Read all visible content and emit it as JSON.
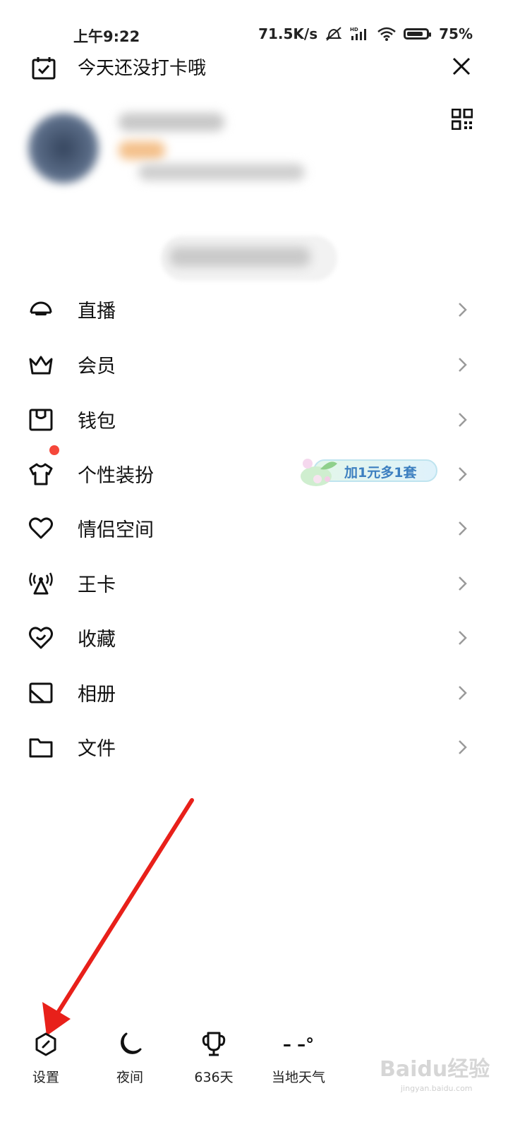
{
  "status_bar": {
    "time": "上午9:22",
    "speed": "71.5K/s",
    "battery": "75%"
  },
  "header": {
    "checkin_text": "今天还没打卡哦"
  },
  "menu": {
    "items": [
      {
        "label": "直播",
        "icon": "live-icon"
      },
      {
        "label": "会员",
        "icon": "crown-icon"
      },
      {
        "label": "钱包",
        "icon": "wallet-icon"
      },
      {
        "label": "个性装扮",
        "icon": "tshirt-icon",
        "promo": "加1元多1套",
        "badge": true
      },
      {
        "label": "情侣空间",
        "icon": "heart-icon"
      },
      {
        "label": "王卡",
        "icon": "signal-tower-icon"
      },
      {
        "label": "收藏",
        "icon": "favorite-icon"
      },
      {
        "label": "相册",
        "icon": "album-icon"
      },
      {
        "label": "文件",
        "icon": "folder-icon"
      }
    ]
  },
  "bottom_bar": {
    "settings": "设置",
    "night": "夜间",
    "days": "636天",
    "weather_value": "– –°",
    "weather": "当地天气"
  },
  "watermark": {
    "brand": "Baidu经验",
    "url": "jingyan.baidu.com"
  },
  "colors": {
    "badge": "#f5473a",
    "promo_text": "#3c7fc0",
    "arrow": "#e8201a"
  }
}
